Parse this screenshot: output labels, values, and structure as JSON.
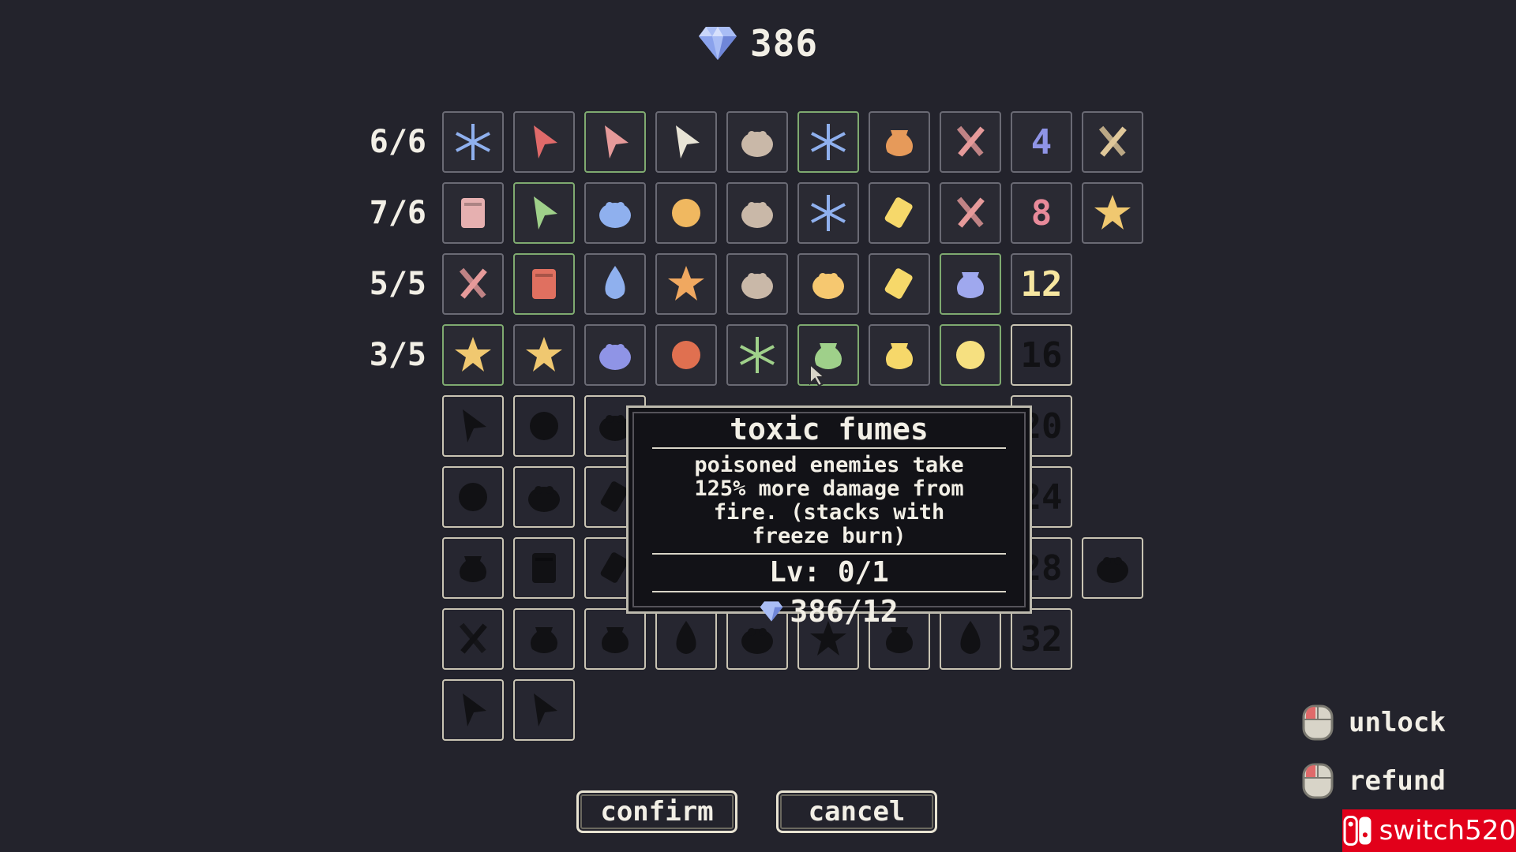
{
  "currency": {
    "gems": "386",
    "gem_icon": "diamond-icon",
    "gem_color": "#9fb4f2"
  },
  "row_labels": [
    "6/6",
    "7/6",
    "5/5",
    "3/5"
  ],
  "cells": [
    {
      "r": 0,
      "c": 0,
      "icon": "snowflake-icon",
      "color": "#8fb0ee"
    },
    {
      "r": 0,
      "c": 1,
      "icon": "arrow-pointer-icon",
      "color": "#e06a6a"
    },
    {
      "r": 0,
      "c": 2,
      "icon": "healing-arrow-icon",
      "color": "#e69a9a",
      "green": true
    },
    {
      "r": 0,
      "c": 3,
      "icon": "double-arrow-icon",
      "color": "#e8e4d6"
    },
    {
      "r": 0,
      "c": 4,
      "icon": "heads-icon",
      "color": "#c9b8a8"
    },
    {
      "r": 0,
      "c": 5,
      "icon": "frost-tree-icon",
      "color": "#8fb0ee",
      "green": true
    },
    {
      "r": 0,
      "c": 6,
      "icon": "pouch-icon",
      "color": "#e69a5a"
    },
    {
      "r": 0,
      "c": 7,
      "icon": "crossed-blades-icon",
      "color": "#e69a9a"
    },
    {
      "r": 0,
      "c": 8,
      "icon": "number-four",
      "text": "4",
      "color": "#8f94e6"
    },
    {
      "r": 0,
      "c": 9,
      "icon": "crossed-swords-icon",
      "color": "#e0c89a"
    },
    {
      "r": 1,
      "c": 0,
      "icon": "scroll-icon",
      "color": "#e6b0b0"
    },
    {
      "r": 1,
      "c": 1,
      "icon": "green-arrow-icon",
      "color": "#9fd08a",
      "green": true
    },
    {
      "r": 1,
      "c": 2,
      "icon": "slime-icon",
      "color": "#8fb0ee"
    },
    {
      "r": 1,
      "c": 3,
      "icon": "target-icon",
      "color": "#f0b860"
    },
    {
      "r": 1,
      "c": 4,
      "icon": "add-ally-icon",
      "color": "#c9b8a8"
    },
    {
      "r": 1,
      "c": 5,
      "icon": "ice-burst-icon",
      "color": "#8fb0ee"
    },
    {
      "r": 1,
      "c": 6,
      "icon": "gold-bar-icon",
      "color": "#f6d86a"
    },
    {
      "r": 1,
      "c": 7,
      "icon": "axe-icon",
      "color": "#e69a9a"
    },
    {
      "r": 1,
      "c": 8,
      "icon": "number-eight",
      "text": "8",
      "color": "#e88a9a"
    },
    {
      "r": 1,
      "c": 9,
      "icon": "star-icon",
      "color": "#f0c870"
    },
    {
      "r": 2,
      "c": 0,
      "icon": "dagger-icon",
      "color": "#e69a9a"
    },
    {
      "r": 2,
      "c": 1,
      "icon": "fire-scroll-icon",
      "color": "#e07060",
      "green": true
    },
    {
      "r": 2,
      "c": 2,
      "icon": "water-drop-icon",
      "color": "#8fb0ee"
    },
    {
      "r": 2,
      "c": 3,
      "icon": "star-icon",
      "color": "#f0a860"
    },
    {
      "r": 2,
      "c": 4,
      "icon": "heads-icon",
      "color": "#c9b8a8"
    },
    {
      "r": 2,
      "c": 5,
      "icon": "frog-icon",
      "color": "#f6c870"
    },
    {
      "r": 2,
      "c": 6,
      "icon": "gold-bar-icon",
      "color": "#f6d86a"
    },
    {
      "r": 2,
      "c": 7,
      "icon": "blue-pot-icon",
      "color": "#9fa8ee",
      "green": true
    },
    {
      "r": 2,
      "c": 8,
      "icon": "number-twelve",
      "text": "12",
      "color": "#f6e6a0"
    },
    {
      "r": 3,
      "c": 0,
      "icon": "star-sword-icon",
      "color": "#f0c870",
      "green": true
    },
    {
      "r": 3,
      "c": 1,
      "icon": "star-orb-icon",
      "color": "#f0c870"
    },
    {
      "r": 3,
      "c": 2,
      "icon": "berries-icon",
      "color": "#8f94e6"
    },
    {
      "r": 3,
      "c": 3,
      "icon": "fire-ring-icon",
      "color": "#e07050"
    },
    {
      "r": 3,
      "c": 4,
      "icon": "toxic-tree-icon",
      "color": "#9fd08a"
    },
    {
      "r": 3,
      "c": 5,
      "icon": "toxic-cauldron-icon",
      "color": "#9fd08a",
      "green": true
    },
    {
      "r": 3,
      "c": 6,
      "icon": "gold-pouch-icon",
      "color": "#f6d86a"
    },
    {
      "r": 3,
      "c": 7,
      "icon": "sun-icon",
      "color": "#f6e080",
      "green": true
    },
    {
      "r": 3,
      "c": 8,
      "icon": "number-sixteen-locked",
      "text": "16",
      "color": "#111114",
      "locked": true
    },
    {
      "r": 4,
      "c": 0,
      "icon": "locked-arrow-icon",
      "color": "#111114",
      "locked": true
    },
    {
      "r": 4,
      "c": 1,
      "icon": "locked-anchor-icon",
      "color": "#111114",
      "locked": true
    },
    {
      "r": 4,
      "c": 2,
      "icon": "locked-helmet-icon",
      "color": "#111114",
      "locked": true
    },
    {
      "r": 4,
      "c": 8,
      "icon": "number-twenty-locked",
      "text": "20",
      "color": "#111114",
      "locked": true
    },
    {
      "r": 5,
      "c": 0,
      "icon": "locked-splash-icon",
      "color": "#111114",
      "locked": true
    },
    {
      "r": 5,
      "c": 1,
      "icon": "locked-boot-icon",
      "color": "#111114",
      "locked": true
    },
    {
      "r": 5,
      "c": 2,
      "icon": "locked-block-icon",
      "color": "#111114",
      "locked": true
    },
    {
      "r": 5,
      "c": 8,
      "icon": "number-twenty-four-locked",
      "text": "24",
      "color": "#111114",
      "locked": true
    },
    {
      "r": 6,
      "c": 0,
      "icon": "locked-bomb-icon",
      "color": "#111114",
      "locked": true
    },
    {
      "r": 6,
      "c": 1,
      "icon": "locked-scroll-icon",
      "color": "#111114",
      "locked": true
    },
    {
      "r": 6,
      "c": 2,
      "icon": "locked-block-icon",
      "color": "#111114",
      "locked": true
    },
    {
      "r": 6,
      "c": 8,
      "icon": "number-twenty-eight-locked",
      "text": "28",
      "color": "#111114",
      "locked": true
    },
    {
      "r": 6,
      "c": 9,
      "icon": "locked-ghost-icon",
      "color": "#111114",
      "locked": true
    },
    {
      "r": 7,
      "c": 0,
      "icon": "locked-bandage-icon",
      "color": "#111114",
      "locked": true
    },
    {
      "r": 7,
      "c": 1,
      "icon": "locked-bomb-icon",
      "color": "#111114",
      "locked": true
    },
    {
      "r": 7,
      "c": 2,
      "icon": "locked-sparkle-pot-icon",
      "color": "#111114",
      "locked": true
    },
    {
      "r": 7,
      "c": 3,
      "icon": "locked-drop-icon",
      "color": "#111114",
      "locked": true
    },
    {
      "r": 7,
      "c": 4,
      "icon": "locked-ghost-icon",
      "color": "#111114",
      "locked": true
    },
    {
      "r": 7,
      "c": 5,
      "icon": "locked-star-icon",
      "color": "#111114",
      "locked": true
    },
    {
      "r": 7,
      "c": 6,
      "icon": "locked-pouch-icon",
      "color": "#111114",
      "locked": true
    },
    {
      "r": 7,
      "c": 7,
      "icon": "locked-balloon-icon",
      "color": "#111114",
      "locked": true
    },
    {
      "r": 7,
      "c": 8,
      "icon": "number-thirty-two-locked",
      "text": "32",
      "color": "#111114",
      "locked": true
    },
    {
      "r": 8,
      "c": 0,
      "icon": "locked-arrows-icon",
      "color": "#111114",
      "locked": true
    },
    {
      "r": 8,
      "c": 1,
      "icon": "locked-sparkle-arrow-icon",
      "color": "#111114",
      "locked": true
    }
  ],
  "tooltip": {
    "title": "toxic fumes",
    "description_lines": [
      "poisoned enemies take",
      "125% more damage from",
      "fire. (stacks with",
      "freeze burn)"
    ],
    "level": "Lv: 0/1",
    "cost": "386/12"
  },
  "buttons": {
    "confirm": "confirm",
    "cancel": "cancel"
  },
  "legend": {
    "unlock": "unlock",
    "refund": "refund"
  },
  "watermark": {
    "text": "switch520"
  }
}
